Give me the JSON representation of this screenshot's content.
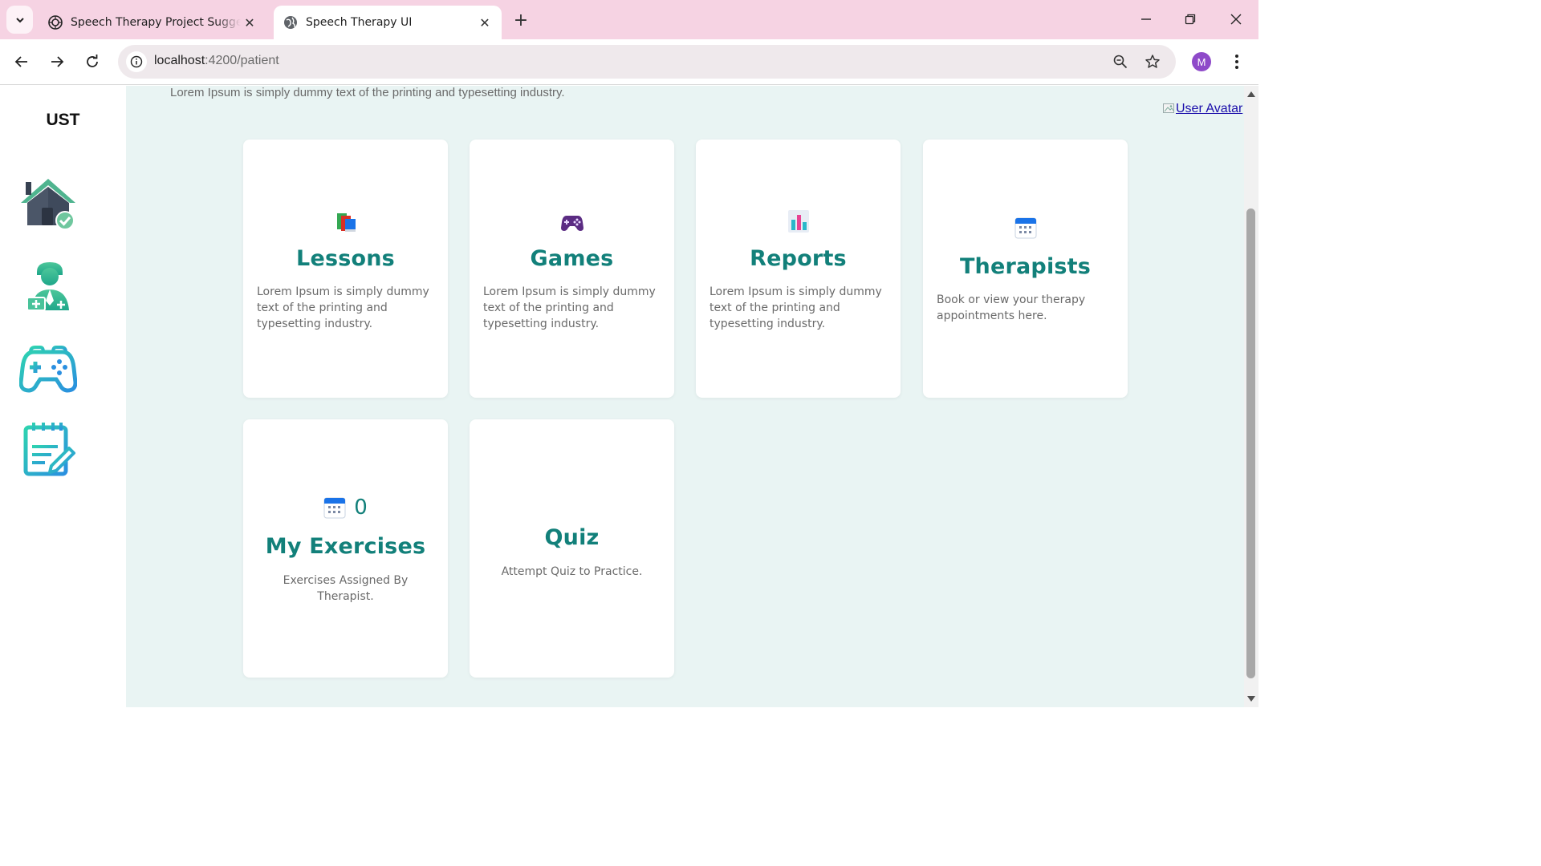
{
  "browser": {
    "tabs": [
      {
        "title": "Speech Therapy Project Suggestions",
        "active": false
      },
      {
        "title": "Speech Therapy UI",
        "active": true
      }
    ],
    "url_host": "localhost",
    "url_path": ":4200/patient",
    "profile_initial": "M"
  },
  "sidebar": {
    "brand": "UST",
    "items": [
      {
        "name": "home-icon"
      },
      {
        "name": "therapist-icon"
      },
      {
        "name": "gamepad-icon"
      },
      {
        "name": "notes-icon"
      }
    ]
  },
  "main": {
    "lead_text": "Lorem Ipsum is simply dummy text of the printing and typesetting industry.",
    "avatar_alt": "User Avatar",
    "cards": [
      {
        "title": "Lessons",
        "icon": "books-icon",
        "desc": "Lorem Ipsum is simply dummy text of the printing and typesetting industry."
      },
      {
        "title": "Games",
        "icon": "video-game-icon",
        "desc": "Lorem Ipsum is simply dummy text of the printing and typesetting industry."
      },
      {
        "title": "Reports",
        "icon": "bar-chart-icon",
        "desc": "Lorem Ipsum is simply dummy text of the printing and typesetting industry."
      },
      {
        "title": "Therapists",
        "icon": "calendar-icon",
        "desc": "Book or view your therapy appointments here."
      },
      {
        "title": "My Exercises",
        "icon": "calendar-icon",
        "count": "0",
        "desc": "Exercises Assigned By Therapist."
      },
      {
        "title": "Quiz",
        "desc": "Attempt Quiz to Practice."
      }
    ]
  },
  "colors": {
    "accent": "#12807a",
    "page_bg": "#e9f4f3",
    "tabstrip": "#f6d3e3"
  }
}
